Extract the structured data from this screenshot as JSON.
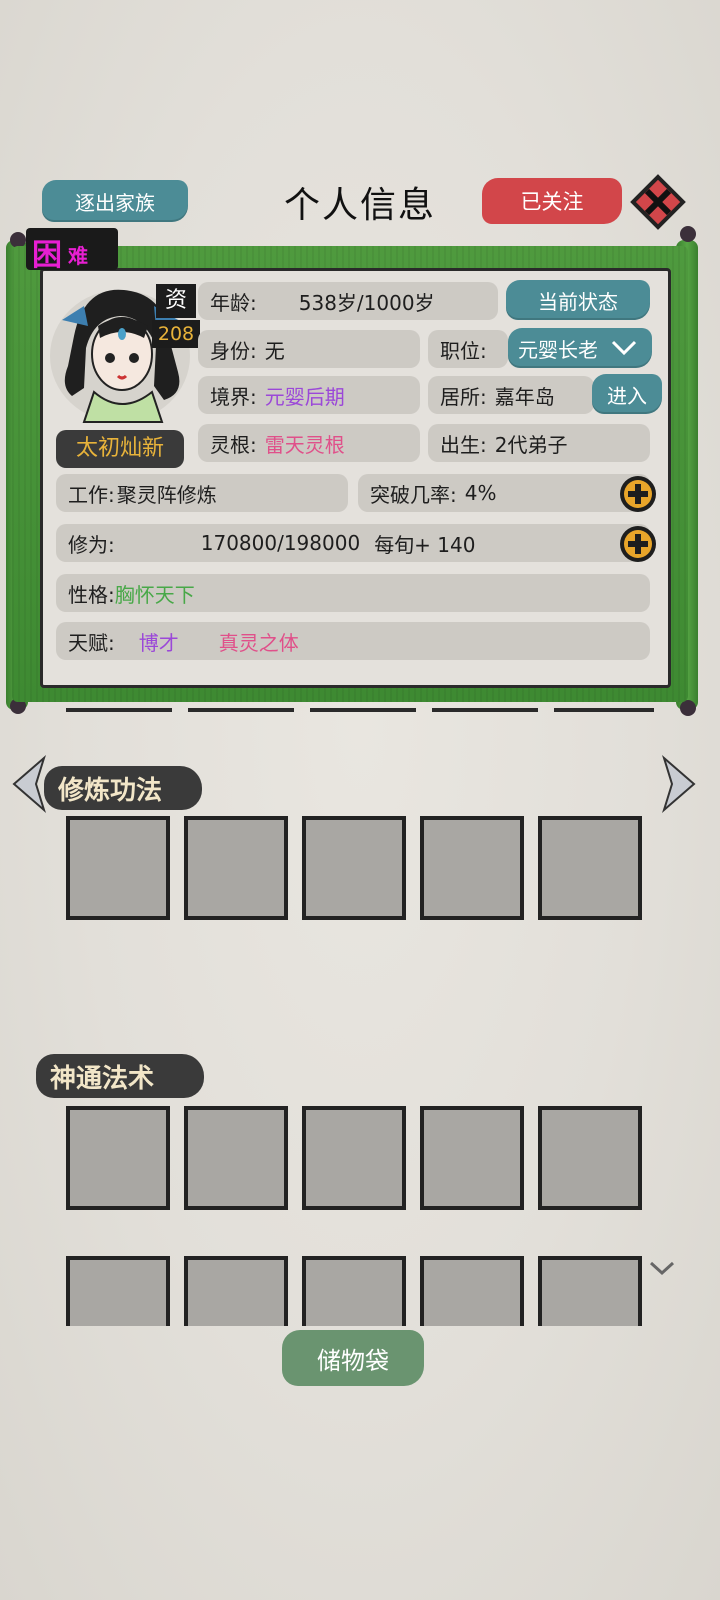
{
  "header": {
    "expel_label": "逐出家族",
    "title": "个人信息",
    "follow_label": "已关注"
  },
  "badge": {
    "main": "困",
    "sub": "难"
  },
  "character": {
    "name": "太初灿新",
    "aptitude_label": "资",
    "aptitude_value": "208",
    "age_label": "年龄:",
    "age_value": "538岁/1000岁",
    "status_button": "当前状态",
    "identity_label": "身份:",
    "identity_value": "无",
    "position_label": "职位:",
    "position_value": "元婴长老",
    "realm_label": "境界:",
    "realm_value": "元婴后期",
    "residence_label": "居所:",
    "residence_value": "嘉年岛",
    "enter_button": "进入",
    "root_label": "灵根:",
    "root_value": "雷天灵根",
    "birth_label": "出生:",
    "birth_value": "2代弟子",
    "work_label": "工作:",
    "work_value": "聚灵阵修炼",
    "breakthrough_label": "突破几率:",
    "breakthrough_value": "4%",
    "cultivation_label": "修为:",
    "cultivation_value": "170800/198000",
    "cultivation_rate": "每旬+ 140",
    "personality_label": "性格:",
    "personality_value": "胸怀天下",
    "talent_label": "天赋:",
    "talents": [
      "博才",
      "真灵之体"
    ]
  },
  "sections": {
    "techniques_label": "修炼功法",
    "spells_label": "神通法术"
  },
  "storage_label": "储物袋",
  "colors": {
    "teal": "#4c8c96",
    "red": "#d2464a",
    "green": "#4f9a3e",
    "purple": "#9b48d8",
    "pink": "#e0508a",
    "green_text": "#48a848",
    "gold": "#e8b33a",
    "magenta": "#e81fd2"
  }
}
